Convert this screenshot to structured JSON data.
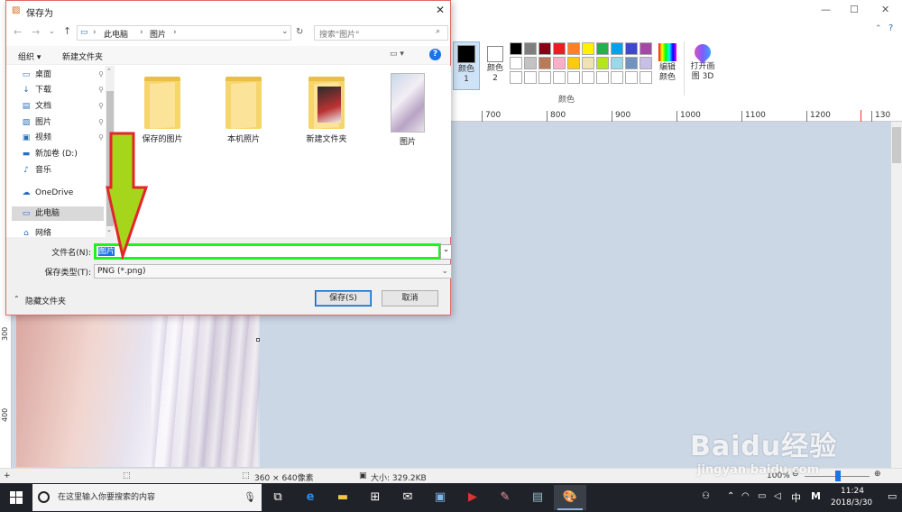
{
  "paint": {
    "ribbon": {
      "color1_label": "颜色 1",
      "color2_label": "颜色 2",
      "colors_group_label": "颜色",
      "edit_colors_label": "编辑颜色",
      "open_paint3d_label": "打开画图 3D",
      "palette_row1": [
        "#000000",
        "#7f7f7f",
        "#880015",
        "#ed1c24",
        "#ff7f27",
        "#fff200",
        "#22b14c",
        "#00a2e8",
        "#3f48cc",
        "#a349a4"
      ],
      "palette_row2": [
        "#ffffff",
        "#c3c3c3",
        "#b97a57",
        "#ffaec9",
        "#ffc90e",
        "#efe4b0",
        "#b5e61d",
        "#99d9ea",
        "#7092be",
        "#c8bfe7"
      ]
    },
    "ruler_h": [
      "700",
      "800",
      "900",
      "1000",
      "1100",
      "1200",
      "130"
    ],
    "ruler_v": [
      "300",
      "400"
    ],
    "status": {
      "dimensions": "360 × 640像素",
      "size": "大小: 329.2KB",
      "zoom": "100%"
    }
  },
  "dialog": {
    "title": "保存为",
    "breadcrumb": [
      "此电脑",
      "图片"
    ],
    "search_placeholder": "搜索\"图片\"",
    "toolbar": {
      "organize": "组织 ▾",
      "new_folder": "新建文件夹"
    },
    "nav_items": [
      {
        "label": "桌面",
        "icon": "desktop-icon",
        "pinned": true
      },
      {
        "label": "下载",
        "icon": "download-icon",
        "pinned": true
      },
      {
        "label": "文档",
        "icon": "document-icon",
        "pinned": true
      },
      {
        "label": "图片",
        "icon": "picture-icon",
        "pinned": true
      },
      {
        "label": "视频",
        "icon": "video-icon",
        "pinned": true
      },
      {
        "label": "新加卷 (D:)",
        "icon": "drive-icon",
        "pinned": false
      },
      {
        "label": "音乐",
        "icon": "music-icon",
        "pinned": false
      },
      {
        "label": "OneDrive",
        "icon": "onedrive-icon",
        "pinned": false
      },
      {
        "label": "此电脑",
        "icon": "computer-icon",
        "pinned": false
      },
      {
        "label": "网络",
        "icon": "network-icon",
        "pinned": false
      }
    ],
    "files": [
      {
        "name": "保存的图片",
        "type": "folder"
      },
      {
        "name": "本机照片",
        "type": "folder"
      },
      {
        "name": "新建文件夹",
        "type": "folder"
      },
      {
        "name": "图片",
        "type": "image"
      }
    ],
    "filename_label": "文件名(N):",
    "filename_value": "图片",
    "filetype_label": "保存类型(T):",
    "filetype_value": "PNG (*.png)",
    "hide_folders": "隐藏文件夹",
    "save_button": "保存(S)",
    "cancel_button": "取消"
  },
  "taskbar": {
    "search_placeholder": "在这里输入你要搜索的内容",
    "time": "11:24",
    "date": "2018/3/30",
    "ime_lang": "中",
    "ime_mode": "M"
  },
  "watermark": {
    "brand": "Baidu经验",
    "url": "jingyan.baidu.com"
  }
}
